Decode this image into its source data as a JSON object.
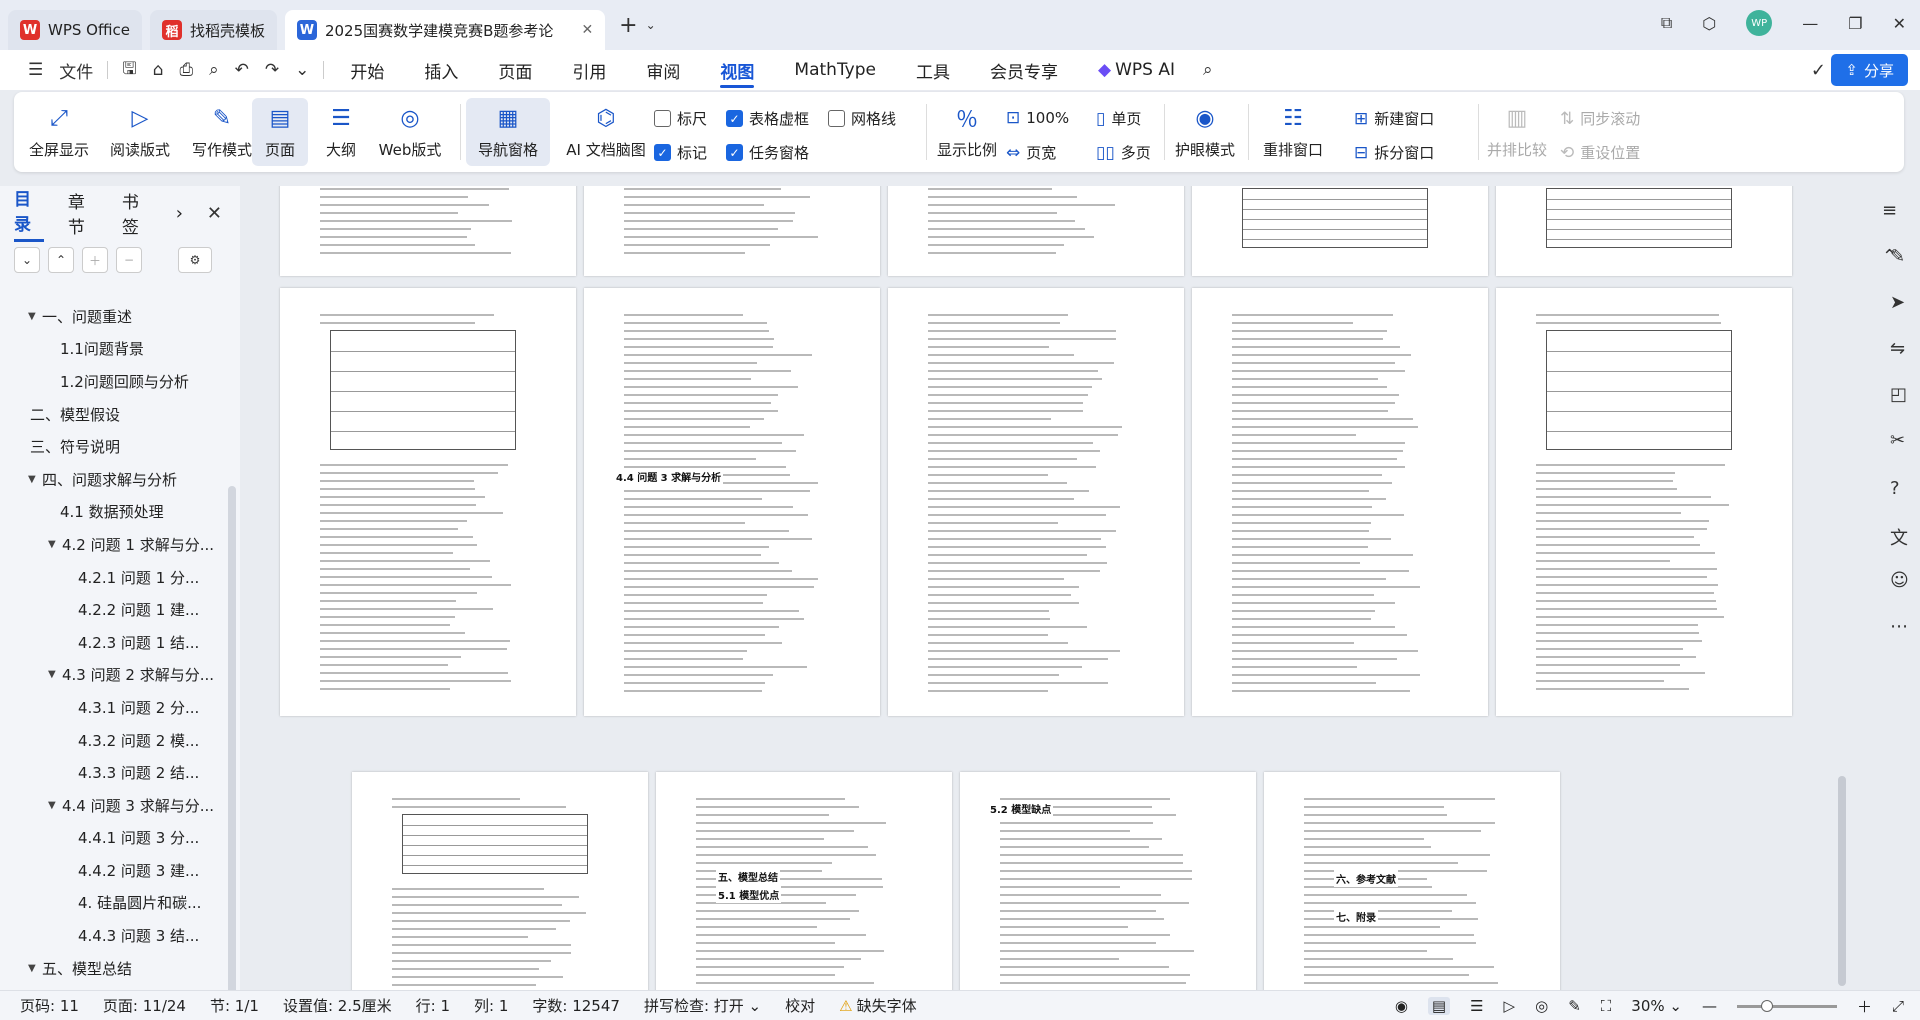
{
  "tabs": [
    {
      "label": "WPS Office",
      "logo": "W",
      "logo_color": "#e0302b"
    },
    {
      "label": "找稻壳模板",
      "logo": "稻",
      "logo_color": "#e0302b"
    },
    {
      "label": "2025国赛数学建模竞赛B题参考论",
      "logo": "W",
      "logo_color": "#2b66d9"
    }
  ],
  "menu": {
    "file": "文件",
    "items": [
      "开始",
      "插入",
      "页面",
      "引用",
      "审阅",
      "视图",
      "MathType",
      "工具",
      "会员专享",
      "WPS AI"
    ],
    "active": "视图",
    "share": "分享"
  },
  "ribbon": {
    "fullscreen": "全屏显示",
    "reading": "阅读版式",
    "writing": "写作模式",
    "page": "页面",
    "outline": "大纲",
    "web": "Web版式",
    "nav_pane": "导航窗格",
    "ai_mindmap": "AI 文档脑图",
    "ruler": "标尺",
    "table_gridlines": "表格虚框",
    "gridlines": "网格线",
    "marks": "标记",
    "task_pane": "任务窗格",
    "zoom_ratio": "显示比例",
    "zoom_100": "100%",
    "page_width": "页宽",
    "single_page": "单页",
    "multi_page": "多页",
    "eye_protect": "护眼模式",
    "rearrange": "重排窗口",
    "new_window": "新建窗口",
    "split_window": "拆分窗口",
    "side_by_side": "并排比较",
    "sync_scroll": "同步滚动",
    "reset_position": "重设位置",
    "checkbox_states": {
      "ruler": false,
      "table_gridlines": true,
      "gridlines": false,
      "marks": true,
      "task_pane": true
    }
  },
  "nav": {
    "tabs": [
      "目录",
      "章节",
      "书签"
    ],
    "toc": [
      {
        "label": "一、问题重述",
        "level": 1,
        "tri": "▼"
      },
      {
        "label": "1.1问题背景",
        "level": 2,
        "tri": ""
      },
      {
        "label": "1.2问题回顾与分析",
        "level": 2,
        "tri": ""
      },
      {
        "label": "二、模型假设",
        "level": 1,
        "tri": ""
      },
      {
        "label": "三、符号说明",
        "level": 1,
        "tri": ""
      },
      {
        "label": "四、问题求解与分析",
        "level": 1,
        "tri": "▼"
      },
      {
        "label": "4.1 数据预处理",
        "level": 2,
        "tri": ""
      },
      {
        "label": "4.2 问题 1 求解与分...",
        "level": 2,
        "tri": "▼"
      },
      {
        "label": "4.2.1 问题 1 分...",
        "level": 3,
        "tri": ""
      },
      {
        "label": "4.2.2 问题 1 建...",
        "level": 3,
        "tri": ""
      },
      {
        "label": "4.2.3 问题 1 结...",
        "level": 3,
        "tri": ""
      },
      {
        "label": "4.3 问题 2 求解与分...",
        "level": 2,
        "tri": "▼"
      },
      {
        "label": "4.3.1 问题 2 分...",
        "level": 3,
        "tri": ""
      },
      {
        "label": "4.3.2 问题 2 模...",
        "level": 3,
        "tri": ""
      },
      {
        "label": "4.3.3 问题 2 结...",
        "level": 3,
        "tri": ""
      },
      {
        "label": "4.4 问题 3 求解与分...",
        "level": 2,
        "tri": "▼"
      },
      {
        "label": "4.4.1 问题 3 分...",
        "level": 3,
        "tri": ""
      },
      {
        "label": "4.4.2 问题 3 建...",
        "level": 3,
        "tri": ""
      },
      {
        "label": "4. 硅晶圆片和碳...",
        "level": 3,
        "tri": ""
      },
      {
        "label": "4.4.3 问题 3 结...",
        "level": 3,
        "tri": ""
      },
      {
        "label": "五、模型总结",
        "level": 1,
        "tri": "▼"
      }
    ]
  },
  "pages": {
    "headings": [
      "4.4 问题 3 求解与分析",
      "五、模型总结",
      "5.1 模型优点",
      "5.2 模型缺点",
      "六、参考文献",
      "七、附录"
    ]
  },
  "status": {
    "page_code": "页码: 11",
    "page": "页面: 11/24",
    "section": "节: 1/1",
    "setting": "设置值: 2.5厘米",
    "row": "行: 1",
    "col": "列: 1",
    "word_count": "字数: 12547",
    "spell": "拼写检查: 打开",
    "proof": "校对",
    "missing_font": "缺失字体",
    "zoom": "30%",
    "zoom_fraction": 0.3
  }
}
